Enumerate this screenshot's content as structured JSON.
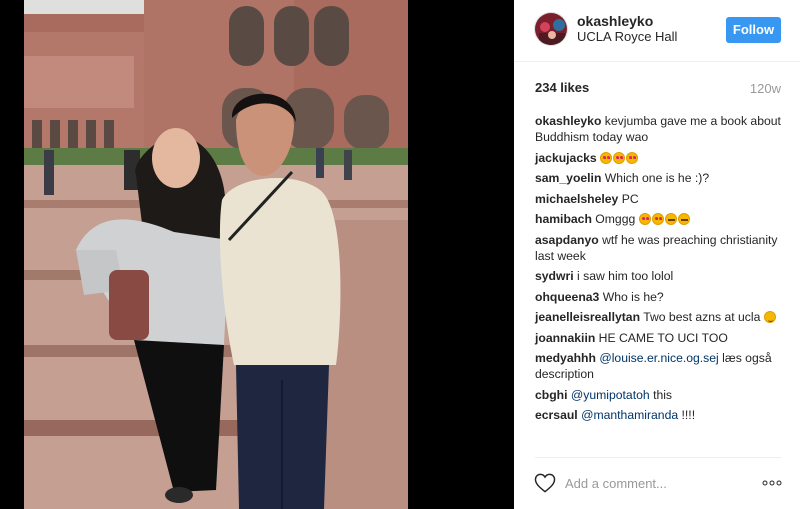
{
  "post": {
    "username": "okashleyko",
    "location": "UCLA Royce Hall",
    "follow_label": "Follow",
    "likes": "234 likes",
    "age": "120w"
  },
  "comments": [
    {
      "user": "okashleyko",
      "text": "kevjumba gave me a book about Buddhism today wao"
    },
    {
      "user": "jackujacks",
      "text": "",
      "emoji": [
        "heart",
        "heart",
        "heart"
      ]
    },
    {
      "user": "sam_yoelin",
      "text": "Which one is he :)?"
    },
    {
      "user": "michaelsheley",
      "text": "PC"
    },
    {
      "user": "hamibach",
      "text": "Omggg",
      "emoji": [
        "heart",
        "heart",
        "cry",
        "cry"
      ]
    },
    {
      "user": "asapdanyo",
      "text": "wtf he was preaching christianity last week"
    },
    {
      "user": "sydwri",
      "text": "i saw him too lolol"
    },
    {
      "user": "ohqueena3",
      "text": "Who is he?"
    },
    {
      "user": "jeanelleisreallytan",
      "text": "Two best azns at ucla",
      "emoji": [
        "wink"
      ]
    },
    {
      "user": "joannakiin",
      "text": "HE CAME TO UCI TOO"
    },
    {
      "user": "medyahhh",
      "mention": "@louise.er.nice.og.sej",
      "text": "læs også description"
    },
    {
      "user": "cbghi",
      "mention": "@yumipotatoh",
      "text": "this"
    },
    {
      "user": "ecrsaul",
      "mention": "@manthamiranda",
      "text": "!!!!"
    }
  ],
  "composer": {
    "placeholder": "Add a comment..."
  },
  "icons": {
    "like": "heart-outline-icon",
    "more": "ellipsis-icon"
  },
  "colors": {
    "follow_bg": "#3897f0",
    "mention": "#003569",
    "muted": "#999999"
  }
}
